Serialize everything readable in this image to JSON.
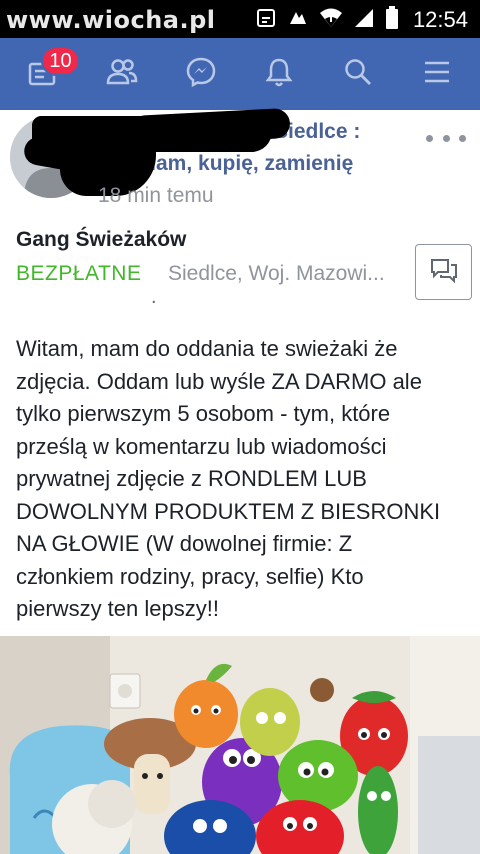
{
  "status_bar": {
    "watermark": "www.wiocha.pl",
    "time": "12:54",
    "icons": [
      "notification-icon",
      "app-icon",
      "wifi-icon",
      "signal-icon",
      "battery-icon"
    ]
  },
  "nav": {
    "badge": "10",
    "icons": [
      "news-feed-icon",
      "friends-icon",
      "messenger-icon",
      "notifications-bell-icon",
      "search-icon",
      "menu-icon"
    ],
    "colors": {
      "bar": "#4267b2",
      "badge": "#f02849"
    }
  },
  "post": {
    "group_line1": "Siedlce :",
    "group_line2": "przedam, kupię, zamienię",
    "time": "18 min temu"
  },
  "listing": {
    "title": "Gang Świeżaków",
    "price": "BEZPŁATNE",
    "location": "Siedlce, Woj. Mazowi...",
    "dot": ".",
    "price_color": "#42b72a"
  },
  "body": {
    "lines": [
      "Witam, mam do oddania te swieżaki że",
      "zdjęcia. Oddam lub wyśle ZA DARMO ale",
      "tylko pierwszym 5 osobom - tym, które",
      "prześlą w komentarzu lub wiadomości",
      "prywatnej zdjęcie z RONDLEM LUB",
      "DOWOLNYM PRODUKTEM Z BIESRONKI",
      "NA GŁOWIE (W dowolnej firmie: Z",
      "członkiem rodziny, pracy, selfie) Kto",
      "pierwszy ten lepszy!!"
    ]
  }
}
